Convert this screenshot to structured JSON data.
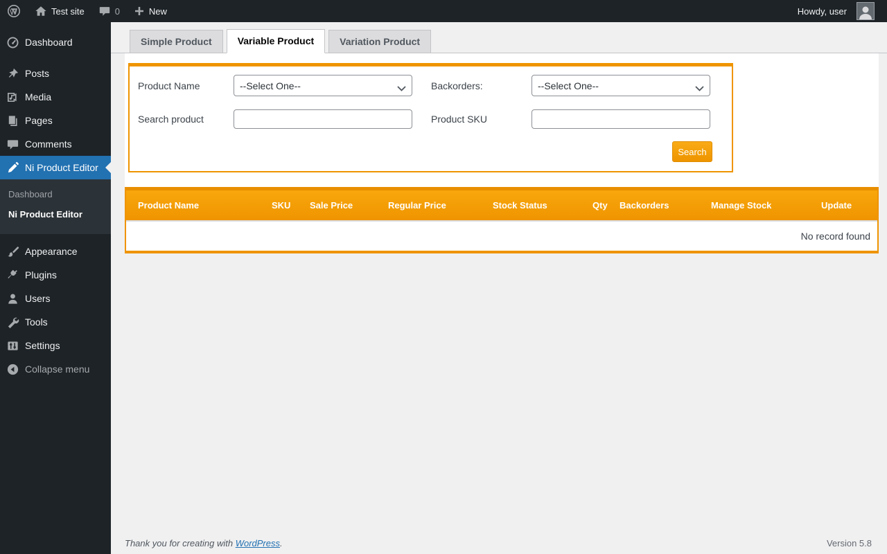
{
  "admin_bar": {
    "site_name": "Test site",
    "comment_count": "0",
    "new_label": "New",
    "howdy": "Howdy, user"
  },
  "sidebar": {
    "items": [
      {
        "label": "Dashboard",
        "icon": "dashboard-icon"
      },
      {
        "label": "Posts",
        "icon": "pushpin-icon"
      },
      {
        "label": "Media",
        "icon": "media-icon"
      },
      {
        "label": "Pages",
        "icon": "pages-icon"
      },
      {
        "label": "Comments",
        "icon": "comments-icon"
      },
      {
        "label": "Ni Product Editor",
        "icon": "pencil-icon",
        "active": true
      },
      {
        "label": "Appearance",
        "icon": "brush-icon"
      },
      {
        "label": "Plugins",
        "icon": "plugin-icon"
      },
      {
        "label": "Users",
        "icon": "user-icon"
      },
      {
        "label": "Tools",
        "icon": "wrench-icon"
      },
      {
        "label": "Settings",
        "icon": "sliders-icon"
      }
    ],
    "submenu": [
      {
        "label": "Dashboard",
        "current": false
      },
      {
        "label": "Ni Product Editor",
        "current": true
      }
    ],
    "collapse_label": "Collapse menu"
  },
  "tabs": [
    {
      "label": "Simple Product",
      "active": false
    },
    {
      "label": "Variable Product",
      "active": true
    },
    {
      "label": "Variation Product",
      "active": false
    }
  ],
  "filter_form": {
    "product_name_label": "Product Name",
    "product_name_value": "--Select One--",
    "backorders_label": "Backorders:",
    "backorders_value": "--Select One--",
    "search_product_label": "Search product",
    "search_product_value": "",
    "product_sku_label": "Product SKU",
    "product_sku_value": "",
    "search_button_label": "Search"
  },
  "table": {
    "columns": [
      "Product Name",
      "SKU",
      "Sale Price",
      "Regular Price",
      "Stock Status",
      "Qty",
      "Backorders",
      "Manage Stock",
      "Update"
    ],
    "empty_message": "No record found"
  },
  "footer": {
    "thanks_prefix": "Thank you for creating with ",
    "link_text": "WordPress",
    "thanks_suffix": ".",
    "version": "Version 5.8"
  },
  "colors": {
    "accent_orange": "#ef9400",
    "accent_orange_light": "#f8a70c",
    "admin_blue": "#2271b1",
    "admin_dark": "#1d2327",
    "submenu_dark": "#2c3338",
    "content_bg": "#f0f0f1"
  }
}
